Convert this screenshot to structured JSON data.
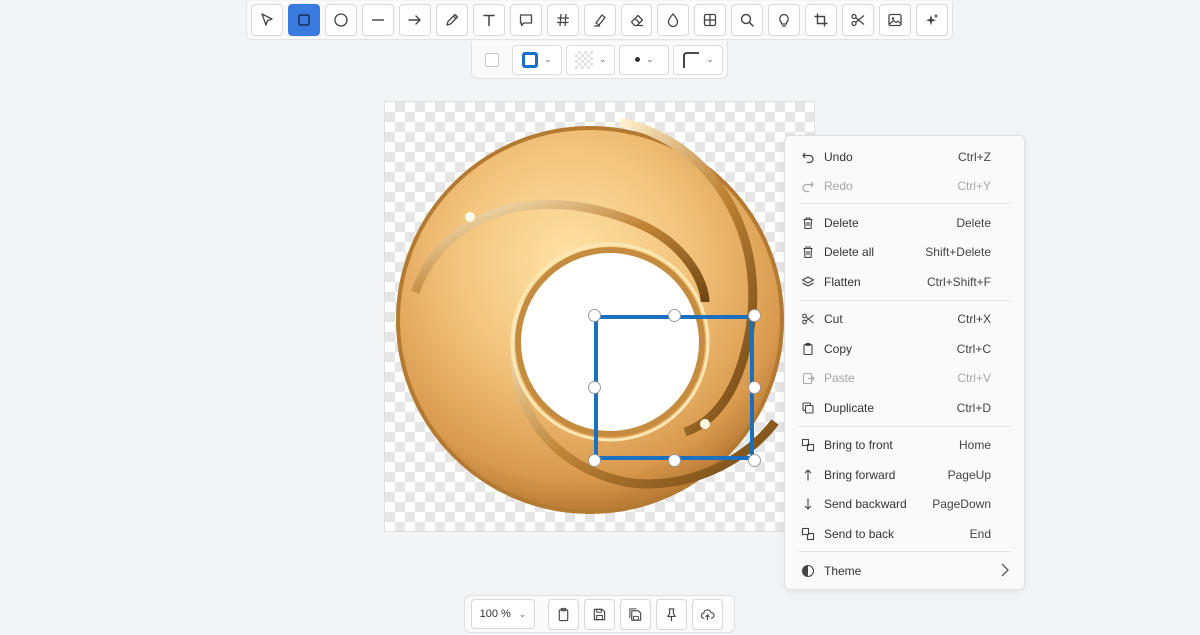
{
  "toolbar": {
    "tools": [
      {
        "name": "select-tool",
        "icon": "cursor-icon",
        "active": false
      },
      {
        "name": "rectangle-tool",
        "icon": "rectangle-icon",
        "active": true
      },
      {
        "name": "ellipse-tool",
        "icon": "circle-icon",
        "active": false
      },
      {
        "name": "line-tool",
        "icon": "line-icon",
        "active": false
      },
      {
        "name": "arrow-tool",
        "icon": "arrow-right-icon",
        "active": false
      },
      {
        "name": "pencil-tool",
        "icon": "pencil-icon",
        "active": false
      },
      {
        "name": "text-tool",
        "icon": "text-icon",
        "active": false
      },
      {
        "name": "callout-tool",
        "icon": "speech-bubble-icon",
        "active": false
      },
      {
        "name": "counter-tool",
        "icon": "hash-icon",
        "active": false
      },
      {
        "name": "highlighter-tool",
        "icon": "highlighter-icon",
        "active": false
      },
      {
        "name": "eraser-tool",
        "icon": "eraser-icon",
        "active": false
      },
      {
        "name": "blur-tool",
        "icon": "droplet-icon",
        "active": false
      },
      {
        "name": "pixelate-tool",
        "icon": "grid-icon",
        "active": false
      },
      {
        "name": "magnifier-tool",
        "icon": "magnifier-icon",
        "active": false
      },
      {
        "name": "spotlight-tool",
        "icon": "lightbulb-icon",
        "active": false
      },
      {
        "name": "crop-tool",
        "icon": "crop-icon",
        "active": false
      },
      {
        "name": "cut-out-tool",
        "icon": "scissors-icon",
        "active": false
      },
      {
        "name": "image-tool",
        "icon": "image-icon",
        "active": false
      },
      {
        "name": "sticker-tool",
        "icon": "sparkles-icon",
        "active": false
      }
    ],
    "accent_color": "#3b7be0"
  },
  "subbar": {
    "border_color": "#1b6fbf",
    "items": [
      "shadow-toggle",
      "border-color",
      "fill-color",
      "border-size",
      "corner-radius"
    ]
  },
  "selection_color": "#1b6fbf",
  "context_menu": {
    "items": [
      {
        "label": "Undo",
        "shortcut": "Ctrl+Z",
        "icon": "undo-icon",
        "disabled": false
      },
      {
        "label": "Redo",
        "shortcut": "Ctrl+Y",
        "icon": "redo-icon",
        "disabled": true
      },
      {
        "label": "Delete",
        "shortcut": "Delete",
        "icon": "trash-icon",
        "disabled": false
      },
      {
        "label": "Delete all",
        "shortcut": "Shift+Delete",
        "icon": "trash-icon",
        "disabled": false
      },
      {
        "label": "Flatten",
        "shortcut": "Ctrl+Shift+F",
        "icon": "layers-icon",
        "disabled": false
      },
      {
        "label": "Cut",
        "shortcut": "Ctrl+X",
        "icon": "scissors-icon",
        "disabled": false
      },
      {
        "label": "Copy",
        "shortcut": "Ctrl+C",
        "icon": "clipboard-icon",
        "disabled": false
      },
      {
        "label": "Paste",
        "shortcut": "Ctrl+V",
        "icon": "paste-icon",
        "disabled": true
      },
      {
        "label": "Duplicate",
        "shortcut": "Ctrl+D",
        "icon": "duplicate-icon",
        "disabled": false
      },
      {
        "label": "Bring to front",
        "shortcut": "Home",
        "icon": "bring-to-front-icon",
        "disabled": false
      },
      {
        "label": "Bring forward",
        "shortcut": "PageUp",
        "icon": "arrow-up-icon",
        "disabled": false
      },
      {
        "label": "Send backward",
        "shortcut": "PageDown",
        "icon": "arrow-down-icon",
        "disabled": false
      },
      {
        "label": "Send to back",
        "shortcut": "End",
        "icon": "send-to-back-icon",
        "disabled": false
      },
      {
        "label": "Theme",
        "shortcut": "",
        "icon": "theme-icon",
        "disabled": false
      }
    ]
  },
  "bottombar": {
    "zoom": "100 %",
    "buttons": [
      {
        "name": "copy-to-clipboard-button",
        "icon": "clipboard-icon"
      },
      {
        "name": "save-button",
        "icon": "save-icon"
      },
      {
        "name": "save-as-button",
        "icon": "save-as-icon"
      },
      {
        "name": "pin-button",
        "icon": "pin-icon"
      },
      {
        "name": "upload-button",
        "icon": "cloud-upload-icon"
      }
    ]
  }
}
